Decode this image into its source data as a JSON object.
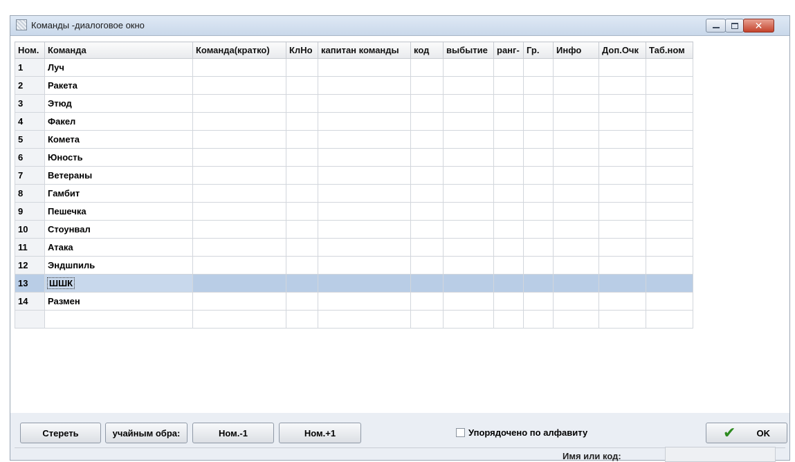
{
  "window": {
    "title": "Команды -диалоговое окно"
  },
  "table": {
    "columns": [
      "Ном.",
      "Команда",
      "Команда(кратко)",
      "КлНо",
      "капитан команды",
      "код",
      "выбытие",
      "ранг-",
      "Гр.",
      "Инфо",
      "Доп.Очк",
      "Таб.ном"
    ],
    "rows": [
      {
        "num": "1",
        "name": "Луч"
      },
      {
        "num": "2",
        "name": "Ракета"
      },
      {
        "num": "3",
        "name": "Этюд"
      },
      {
        "num": "4",
        "name": "Факел"
      },
      {
        "num": "5",
        "name": "Комета"
      },
      {
        "num": "6",
        "name": "Юность"
      },
      {
        "num": "7",
        "name": "Ветераны"
      },
      {
        "num": "8",
        "name": "Гамбит"
      },
      {
        "num": "9",
        "name": "Пешечка"
      },
      {
        "num": "10",
        "name": "Стоунвал"
      },
      {
        "num": "11",
        "name": "Атака"
      },
      {
        "num": "12",
        "name": "Эндшпиль"
      },
      {
        "num": "13",
        "name": "ШШК"
      },
      {
        "num": "14",
        "name": "Размен"
      },
      {
        "num": "",
        "name": ""
      }
    ],
    "selected_row_num": "13"
  },
  "buttons": {
    "erase": "Стереть",
    "random": "учайным обра:",
    "num_minus": "Ном.-1",
    "num_plus": "Ном.+1",
    "ok": "OK"
  },
  "checkbox": {
    "label": "Упорядочено по алфавиту",
    "checked": false
  },
  "status": {
    "label": "Имя или код:",
    "value": ""
  },
  "colors": {
    "selection": "#b9cde6",
    "ok_check": "#2d8a1f",
    "close_button": "#c4432c"
  }
}
